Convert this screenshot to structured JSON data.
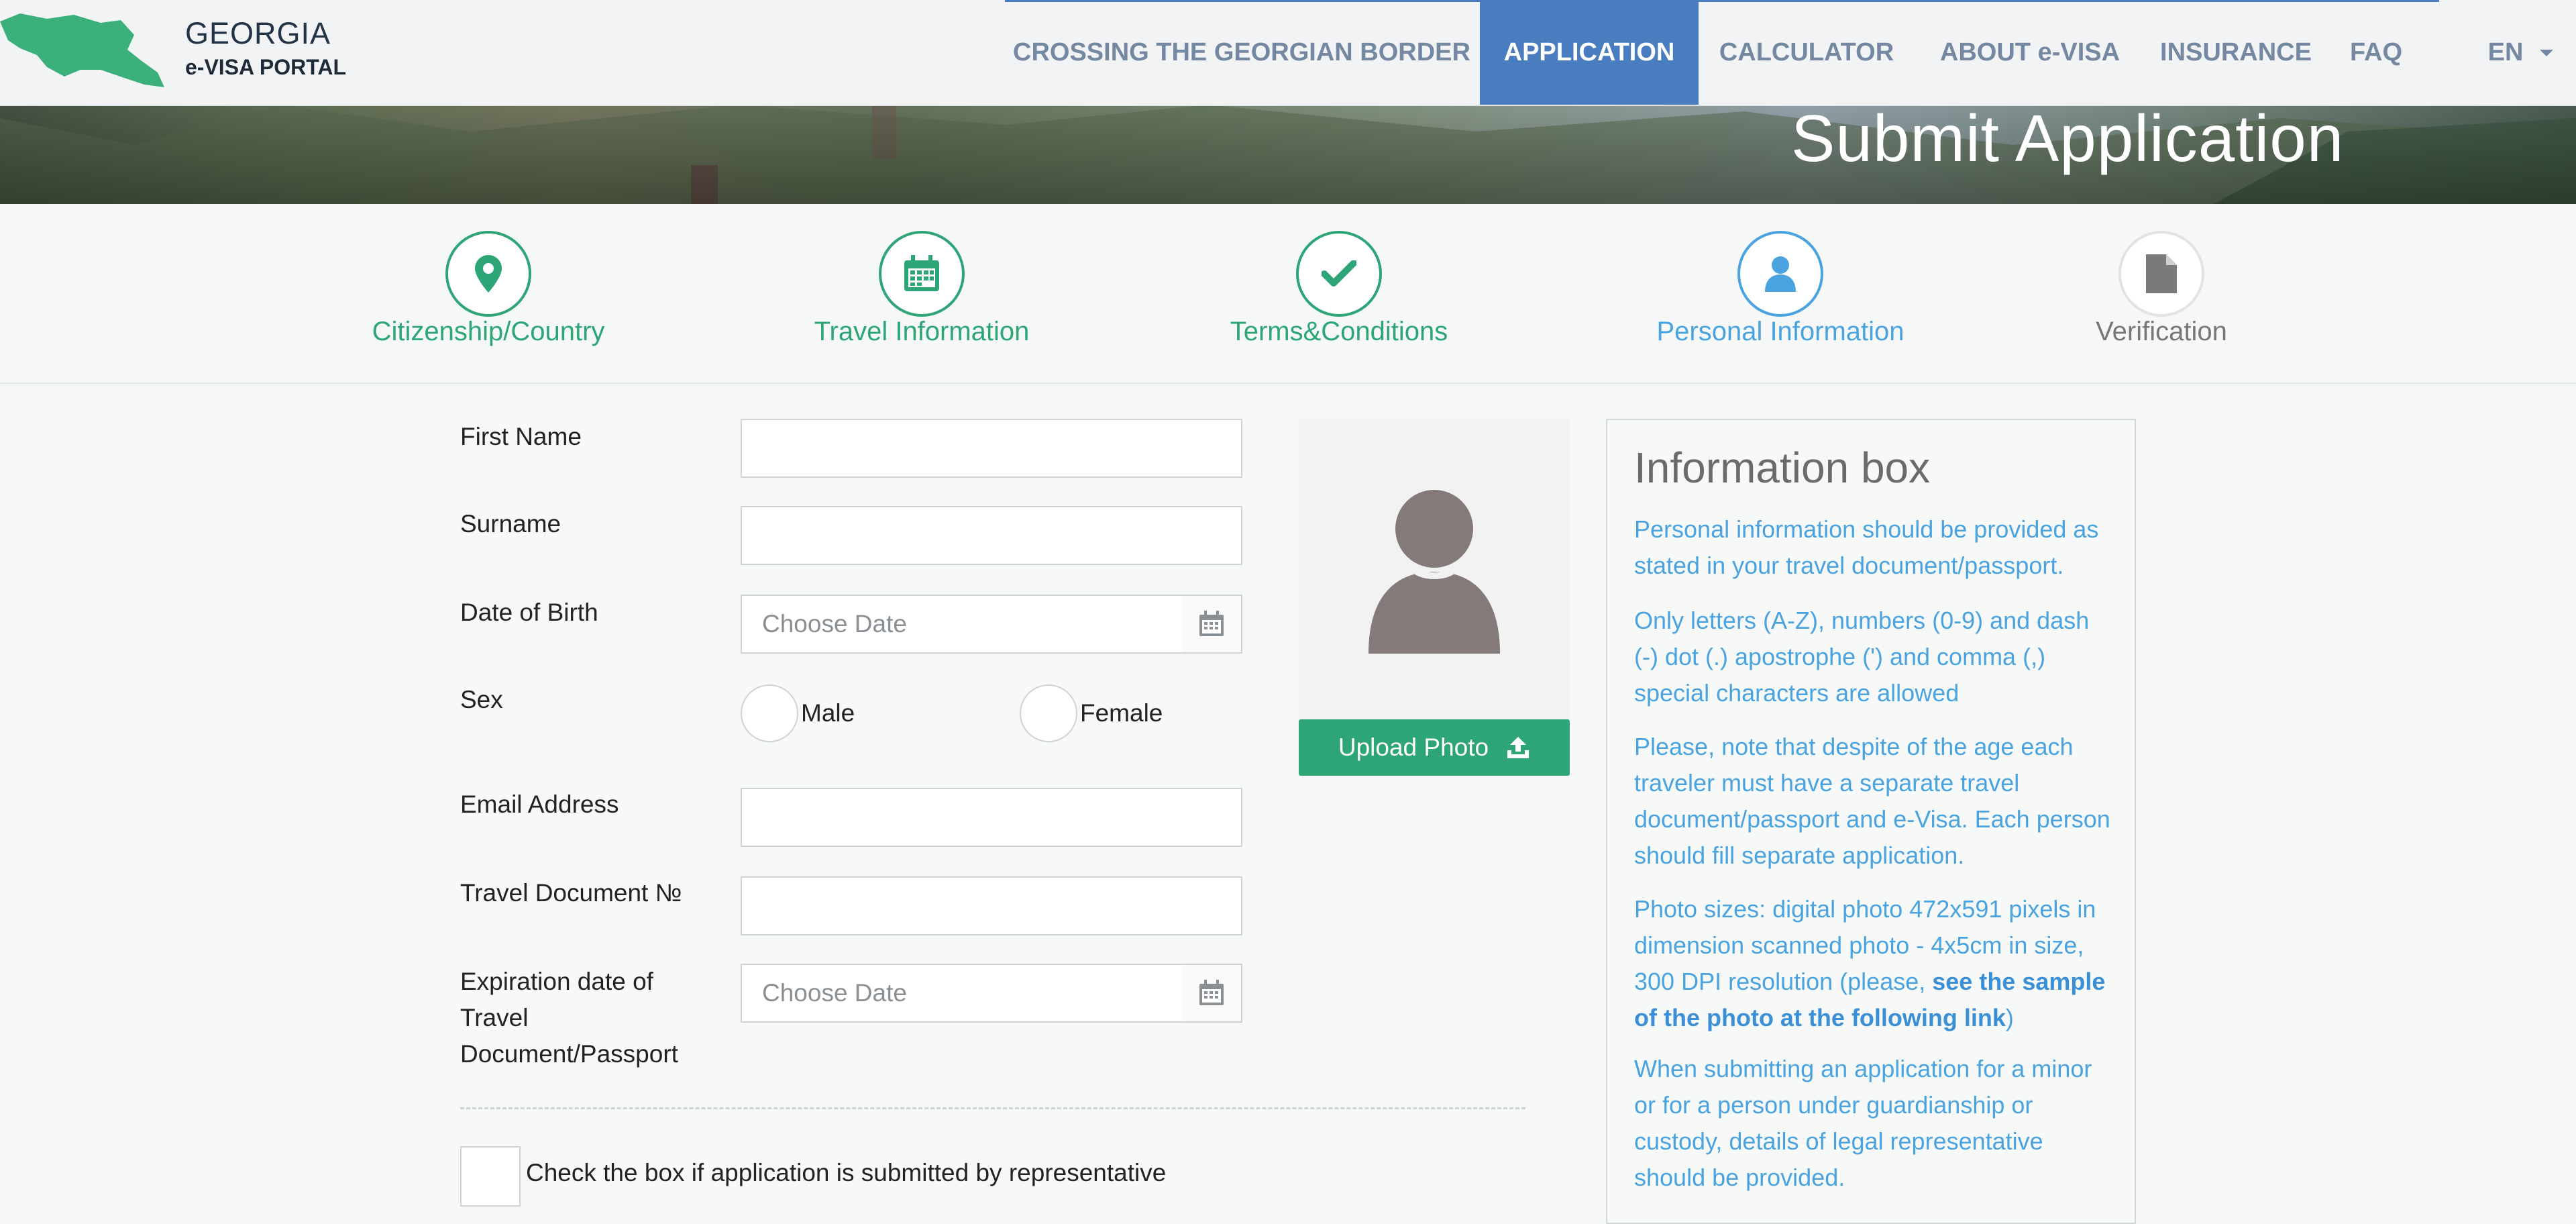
{
  "header": {
    "logo_title": "GEORGIA",
    "logo_subtitle": "e-VISA PORTAL",
    "nav": [
      {
        "label": "CROSSING THE GEORGIAN BORDER",
        "active": false
      },
      {
        "label": "APPLICATION",
        "active": true
      },
      {
        "label": "CALCULATOR",
        "active": false
      },
      {
        "label": "ABOUT e-VISA",
        "active": false
      },
      {
        "label": "INSURANCE",
        "active": false
      },
      {
        "label": "FAQ",
        "active": false
      }
    ],
    "language": "EN"
  },
  "banner": {
    "title": "Submit Application"
  },
  "steps": [
    {
      "label": "Citizenship/Country",
      "icon": "map-pin-icon",
      "status": "done"
    },
    {
      "label": "Travel Information",
      "icon": "calendar-icon",
      "status": "done"
    },
    {
      "label": "Terms&Conditions",
      "icon": "check-icon",
      "status": "done"
    },
    {
      "label": "Personal Information",
      "icon": "user-icon",
      "status": "current"
    },
    {
      "label": "Verification",
      "icon": "document-icon",
      "status": "pending"
    }
  ],
  "form": {
    "first_name_label": "First Name",
    "first_name_value": "",
    "surname_label": "Surname",
    "surname_value": "",
    "dob_label": "Date of Birth",
    "dob_placeholder": "Choose Date",
    "sex_label": "Sex",
    "sex_options": [
      "Male",
      "Female"
    ],
    "email_label": "Email Address",
    "email_value": "",
    "travel_doc_label": "Travel Document №",
    "travel_doc_value": "",
    "expiration_label": "Expiration date of Travel Document/Passport",
    "expiration_placeholder": "Choose Date",
    "representative_label": "Check the box if application is submitted by representative"
  },
  "photo": {
    "upload_label": "Upload Photo"
  },
  "info_box": {
    "title": "Information box",
    "p1": "Personal information should be provided as stated in your travel document/passport.",
    "p2": "Only letters (A-Z), numbers (0-9) and dash (-) dot (.) apostrophe (') and comma (,) special characters are allowed",
    "p3": "Please, note that despite of the age each traveler must have a separate travel document/passport and e-Visa. Each person should fill separate application.",
    "p4_text": "Photo sizes: digital photo 472x591 pixels in dimension scanned photo - 4x5cm in size, 300 DPI resolution (please, ",
    "p4_link": "see the sample of the photo at the following link",
    "p4_end": ")",
    "p5": "When submitting an application for a minor or for a person under guardianship or custody, details of legal representative should be provided."
  },
  "colors": {
    "nav_active": "#4a7dbf",
    "step_done": "#2ea577",
    "step_current": "#4aa3df",
    "upload_button": "#2ea577",
    "info_text": "#4aa3df"
  }
}
